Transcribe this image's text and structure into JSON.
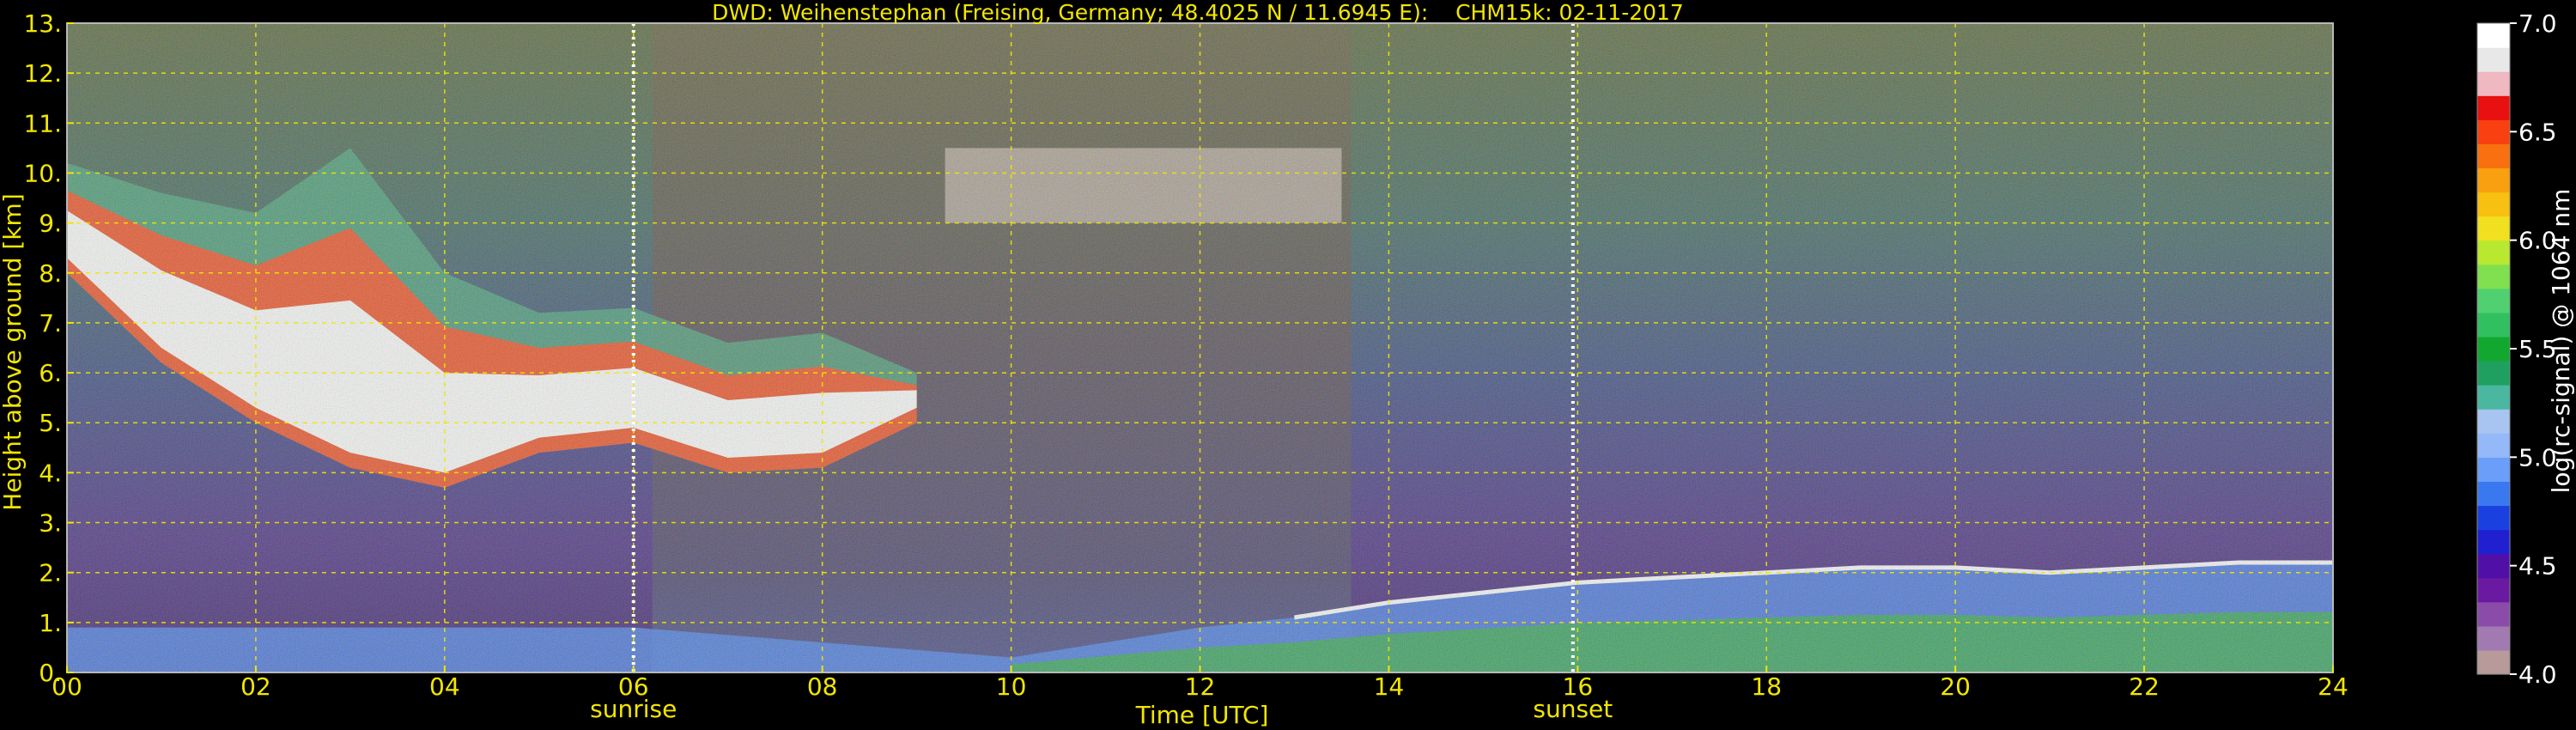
{
  "chart_data": {
    "type": "heatmap",
    "title": "DWD: Weihenstephan (Freising, Germany; 48.4025 N / 11.6945 E):    CHM15k: 02-11-2017",
    "xlabel": "Time [UTC]",
    "ylabel": "Height above ground [km]",
    "xlim": [
      0,
      24
    ],
    "ylim": [
      0,
      13
    ],
    "grid": true,
    "x_ticks": [
      "00",
      "02",
      "04",
      "06",
      "08",
      "10",
      "12",
      "14",
      "16",
      "18",
      "20",
      "22",
      "24"
    ],
    "y_ticks": [
      "0.",
      "1.",
      "2.",
      "3.",
      "4.",
      "5.",
      "6.",
      "7.",
      "8.",
      "9.",
      "10.",
      "11.",
      "12.",
      "13."
    ],
    "annotations": [
      {
        "x": 6.0,
        "label": "sunrise"
      },
      {
        "x": 15.95,
        "label": "sunset"
      }
    ],
    "colorbar": {
      "label": "log(rc-signal) @ 1064 nm",
      "range": [
        4.0,
        7.0
      ],
      "ticks": [
        "4.0",
        "4.5",
        "5.0",
        "5.5",
        "6.0",
        "6.5",
        "7.0"
      ],
      "colors": [
        "#b89a9a",
        "#a07ab0",
        "#8a4ca8",
        "#6a1aa0",
        "#5010a8",
        "#2020d0",
        "#1a40e0",
        "#3a78f0",
        "#6a9ef8",
        "#94b8f8",
        "#a8c4f0",
        "#4ab8a0",
        "#20a060",
        "#12a830",
        "#30c060",
        "#50d070",
        "#80e050",
        "#b8e830",
        "#f0e020",
        "#f8c010",
        "#f8a010",
        "#f87010",
        "#f84010",
        "#e81010",
        "#f0b8c0",
        "#e8e8e8",
        "#ffffff"
      ]
    },
    "features": [
      {
        "name": "cirrus",
        "x_start": 0,
        "x_end": 9,
        "base_km": [
          8.0,
          6.2,
          5.0,
          4.1,
          3.7,
          4.4,
          4.6,
          4.0,
          4.1,
          5.0
        ],
        "top_km": [
          10.2,
          9.6,
          9.2,
          10.5,
          8.0,
          7.2,
          7.3,
          6.6,
          6.8,
          6.0
        ]
      },
      {
        "name": "upper-cloud",
        "x_start": 9.3,
        "x_end": 13.5,
        "base_km": 9.0,
        "top_km": 10.5
      },
      {
        "name": "boundary-layer-top",
        "x": [
          0,
          6,
          8,
          10,
          12,
          13,
          14,
          15,
          16,
          17,
          18,
          19,
          20,
          21,
          22,
          23,
          24
        ],
        "top_km": [
          0.9,
          0.9,
          0.6,
          0.3,
          0.9,
          1.1,
          1.4,
          1.6,
          1.8,
          1.9,
          2.0,
          2.1,
          2.1,
          2.0,
          2.1,
          2.2,
          2.2
        ]
      }
    ]
  }
}
